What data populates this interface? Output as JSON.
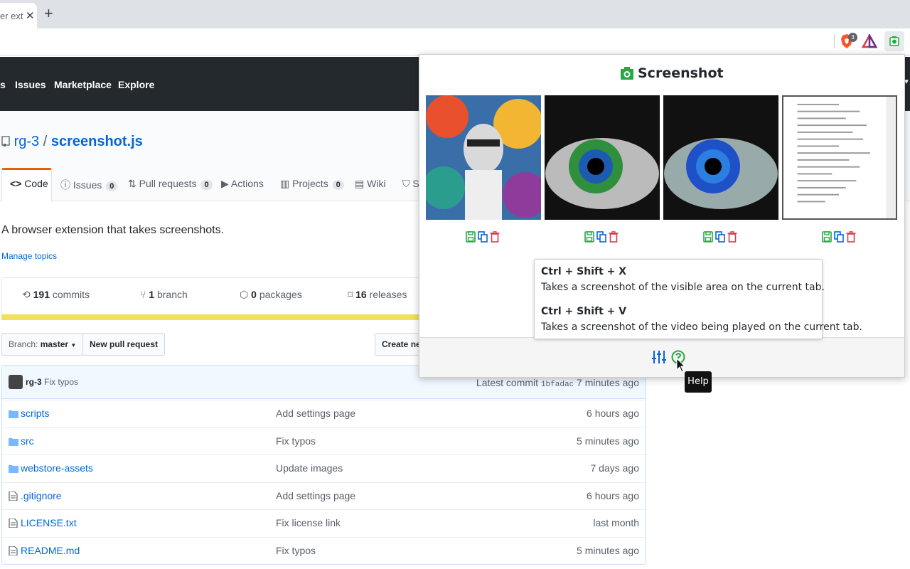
{
  "browser": {
    "tab_title": "er ext",
    "close_glyph": "✕",
    "new_tab_glyph": "+",
    "brave_badge": "3"
  },
  "github_nav": {
    "items": [
      "s",
      "Issues",
      "Marketplace",
      "Explore"
    ]
  },
  "repo": {
    "owner": "rg-3",
    "separator": "/",
    "name": "screenshot.js",
    "tabs": [
      {
        "label": "Code"
      },
      {
        "label": "Issues",
        "count": "0"
      },
      {
        "label": "Pull requests",
        "count": "0"
      },
      {
        "label": "Actions"
      },
      {
        "label": "Projects",
        "count": "0"
      },
      {
        "label": "Wiki"
      },
      {
        "label": "S"
      }
    ],
    "description": "A browser extension that takes screenshots.",
    "manage_topics": "Manage topics",
    "summary": [
      {
        "num": "191",
        "label": "commits"
      },
      {
        "num": "1",
        "label": "branch"
      },
      {
        "num": "0",
        "label": "packages"
      },
      {
        "num": "16",
        "label": "releases"
      }
    ],
    "branch_label": "Branch:",
    "branch_value": "master",
    "new_pr": "New pull request",
    "create_new": "Create ne",
    "commit_user": "rg-3",
    "commit_msg": "Fix typos",
    "latest_label": "Latest commit",
    "latest_hash": "1bfadac",
    "latest_age": "7 minutes ago",
    "files": [
      {
        "type": "dir",
        "name": "scripts",
        "msg": "Add settings page",
        "age": "6 hours ago"
      },
      {
        "type": "dir",
        "name": "src",
        "msg": "Fix typos",
        "age": "5 minutes ago"
      },
      {
        "type": "dir",
        "name": "webstore-assets",
        "msg": "Update images",
        "age": "7 days ago"
      },
      {
        "type": "file",
        "name": ".gitignore",
        "msg": "Add settings page",
        "age": "6 hours ago"
      },
      {
        "type": "file",
        "name": "LICENSE.txt",
        "msg": "Fix license link",
        "age": "last month"
      },
      {
        "type": "file",
        "name": "README.md",
        "msg": "Fix typos",
        "age": "5 minutes ago"
      }
    ]
  },
  "popup": {
    "title": "Screenshot",
    "shortcuts": [
      {
        "keys": "Ctrl + Shift + X",
        "desc": "Takes a screenshot of the visible area on the current tab."
      },
      {
        "keys": "Ctrl + Shift + V",
        "desc": "Takes a screenshot of the video being played on the current tab."
      }
    ],
    "help_tooltip": "Help"
  },
  "colors": {
    "gh_dark": "#24292e",
    "link": "#0366d6",
    "accent_green": "#28a745",
    "accent_blue": "#0366d6",
    "accent_red": "#d73a49",
    "lang_yellow": "#f1e05a",
    "tab_orange": "#e36209"
  }
}
